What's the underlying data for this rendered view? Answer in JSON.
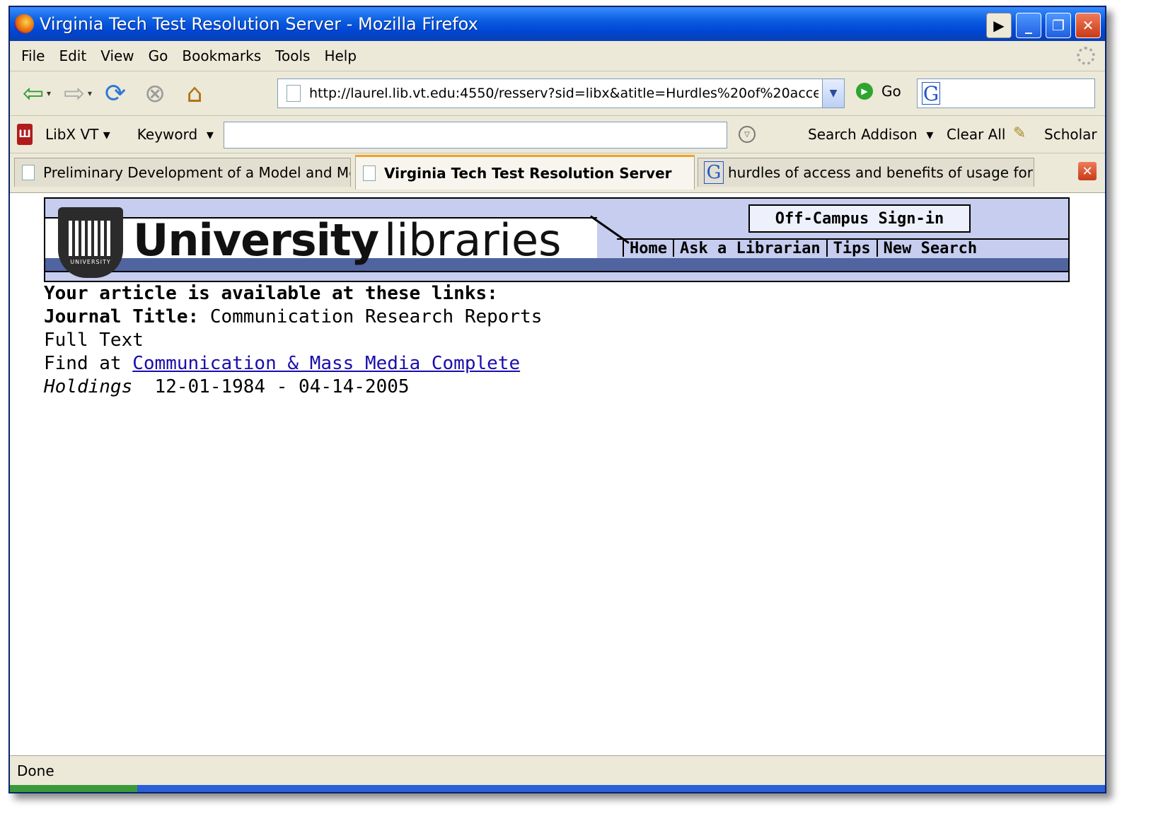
{
  "window": {
    "title": "Virginia Tech Test Resolution Server - Mozilla Firefox"
  },
  "menu": [
    "File",
    "Edit",
    "View",
    "Go",
    "Bookmarks",
    "Tools",
    "Help"
  ],
  "nav": {
    "url": "http://laurel.lib.vt.edu:4550/resserv?sid=libx&atitle=Hurdles%20of%20acce",
    "go_label": "Go"
  },
  "libx": {
    "menu_label": "LibX VT",
    "keyword_label": "Keyword",
    "search_input_value": "",
    "search_label": "Search Addison",
    "clear_label": "Clear All",
    "scholar_label": "Scholar"
  },
  "tabs": [
    {
      "label": "Preliminary Development of a Model and Me…"
    },
    {
      "label": "Virginia Tech Test Resolution Server"
    },
    {
      "label": "hurdles of access and benefits of usage for …"
    }
  ],
  "banner": {
    "logo_bold": "University",
    "logo_light": "libraries",
    "seal_text": "UNIVERSITY",
    "signin_label": "Off-Campus Sign-in",
    "links": [
      "Home",
      "Ask a Librarian",
      "Tips",
      "New Search"
    ]
  },
  "article": {
    "heading": "Your article is available at these links:",
    "journal_label": "Journal Title:",
    "journal_value": "Communication Research Reports",
    "full_text": "Full Text",
    "find_at": "Find at",
    "database_link": "Communication & Mass Media Complete",
    "holdings_label": "Holdings",
    "holdings_value": "12-01-1984 - 04-14-2005"
  },
  "status": {
    "text": "Done"
  },
  "colors": {
    "titlebar": "#0046d5",
    "link": "#1a0dab",
    "banner_bg": "#c6cdee",
    "banner_band": "#5064a0"
  }
}
